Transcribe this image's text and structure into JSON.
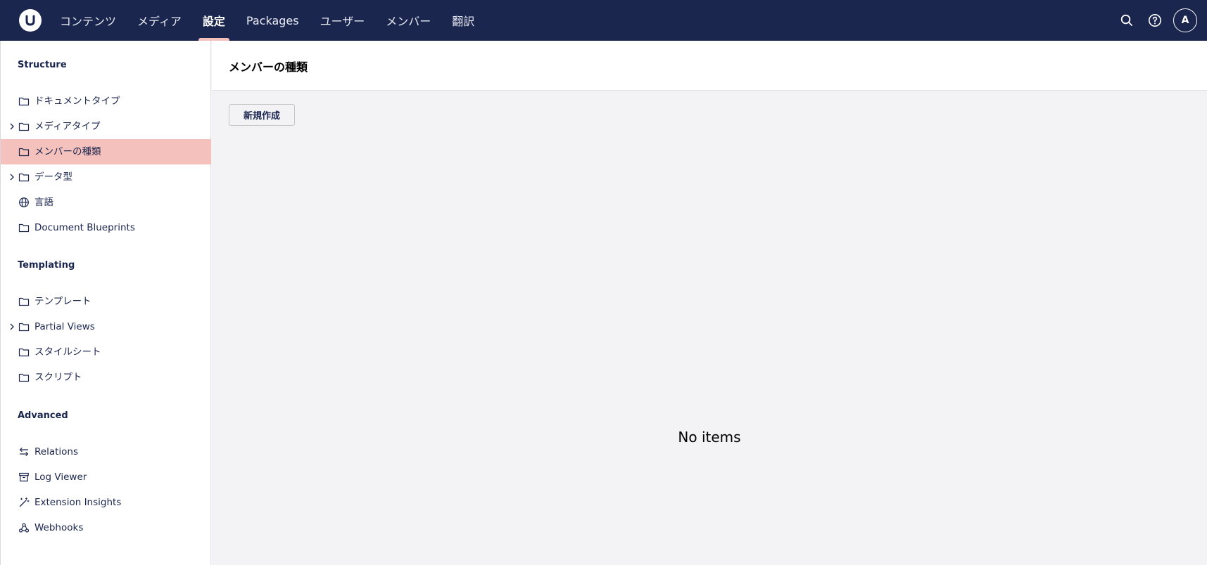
{
  "header": {
    "nav": [
      {
        "label": "コンテンツ"
      },
      {
        "label": "メディア"
      },
      {
        "label": "設定"
      },
      {
        "label": "Packages"
      },
      {
        "label": "ユーザー"
      },
      {
        "label": "メンバー"
      },
      {
        "label": "翻訳"
      }
    ],
    "active_nav": "設定",
    "avatar_initial": "A"
  },
  "sidebar": {
    "sections": [
      {
        "title": "Structure",
        "items": [
          {
            "label": "ドキュメントタイプ",
            "icon": "folder-icon",
            "expandable": false
          },
          {
            "label": "メディアタイプ",
            "icon": "folder-icon",
            "expandable": true
          },
          {
            "label": "メンバーの種類",
            "icon": "folder-icon",
            "expandable": false,
            "active": true
          },
          {
            "label": "データ型",
            "icon": "folder-icon",
            "expandable": true
          },
          {
            "label": "言語",
            "icon": "globe-icon",
            "expandable": false
          },
          {
            "label": "Document Blueprints",
            "icon": "folder-icon",
            "expandable": false
          }
        ]
      },
      {
        "title": "Templating",
        "items": [
          {
            "label": "テンプレート",
            "icon": "folder-icon",
            "expandable": false
          },
          {
            "label": "Partial Views",
            "icon": "folder-icon",
            "expandable": true
          },
          {
            "label": "スタイルシート",
            "icon": "folder-icon",
            "expandable": false
          },
          {
            "label": "スクリプト",
            "icon": "folder-icon",
            "expandable": false
          }
        ]
      },
      {
        "title": "Advanced",
        "items": [
          {
            "label": "Relations",
            "icon": "arrows-swap-icon",
            "expandable": false
          },
          {
            "label": "Log Viewer",
            "icon": "archive-box-icon",
            "expandable": false
          },
          {
            "label": "Extension Insights",
            "icon": "magic-wand-icon",
            "expandable": false
          },
          {
            "label": "Webhooks",
            "icon": "webhook-icon",
            "expandable": false
          }
        ]
      }
    ]
  },
  "main": {
    "title": "メンバーの種類",
    "create_label": "新規作成",
    "empty_text": "No items"
  },
  "colors": {
    "topbar": "#1b264f",
    "active_item": "#f5c1bc",
    "background": "#f3f3f5"
  }
}
